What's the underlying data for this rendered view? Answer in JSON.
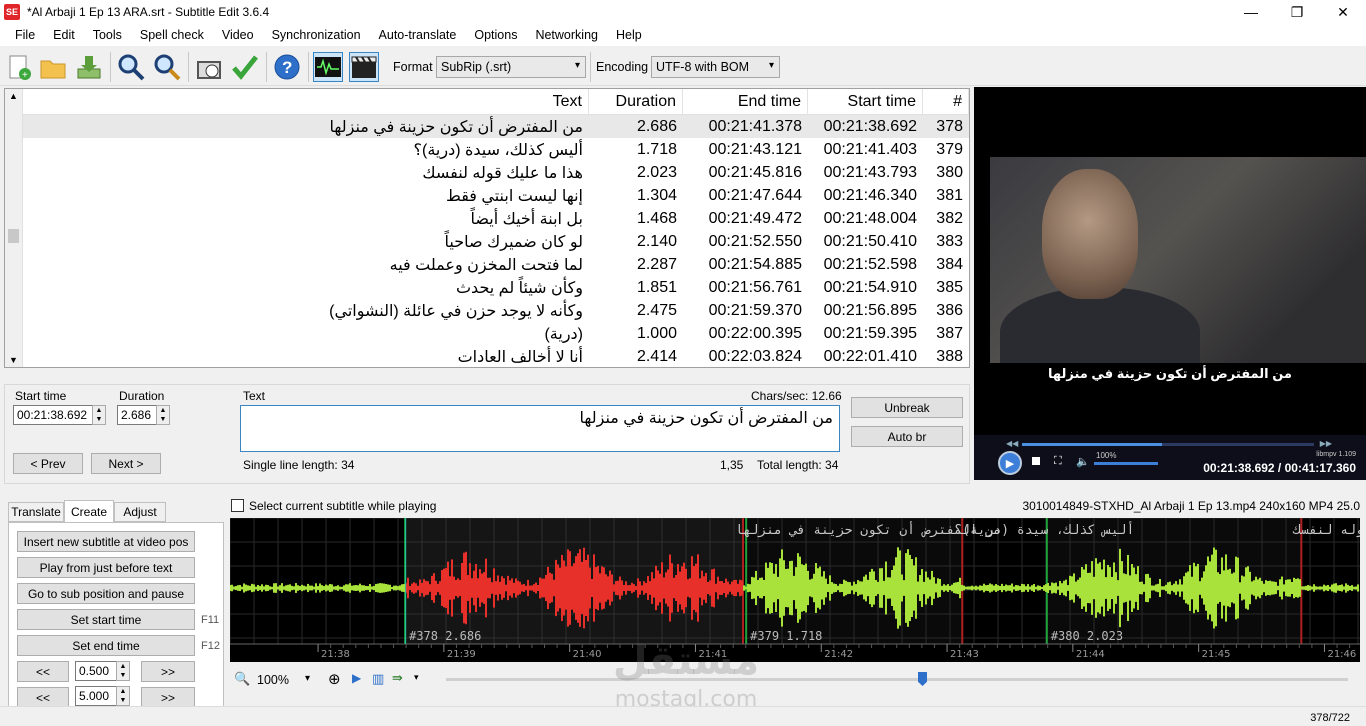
{
  "window": {
    "title": "*Al Arbaji 1 Ep 13 ARA.srt - Subtitle Edit 3.6.4",
    "icon_text": "SE"
  },
  "menu": [
    "File",
    "Edit",
    "Tools",
    "Spell check",
    "Video",
    "Synchronization",
    "Auto-translate",
    "Options",
    "Networking",
    "Help"
  ],
  "toolbar": {
    "format_label": "Format",
    "format_value": "SubRip (.srt)",
    "encoding_label": "Encoding",
    "encoding_value": "UTF-8 with BOM",
    "icons": [
      "new-file-icon",
      "open-folder-icon",
      "download-icon",
      "find-icon",
      "replace-icon",
      "visual-sync-icon",
      "spell-check-icon",
      "help-icon",
      "waveform-toggle-icon",
      "video-toggle-icon"
    ]
  },
  "grid": {
    "columns": [
      "Text",
      "Duration",
      "End time",
      "Start time",
      "#"
    ],
    "rows": [
      {
        "n": "378",
        "start": "00:21:38.692",
        "end": "00:21:41.378",
        "dur": "2.686",
        "text": "من المفترض أن تكون حزينة في منزلها"
      },
      {
        "n": "379",
        "start": "00:21:41.403",
        "end": "00:21:43.121",
        "dur": "1.718",
        "text": "أليس كذلك، سيدة (درية)؟"
      },
      {
        "n": "380",
        "start": "00:21:43.793",
        "end": "00:21:45.816",
        "dur": "2.023",
        "text": "هذا ما عليك قوله لنفسك"
      },
      {
        "n": "381",
        "start": "00:21:46.340",
        "end": "00:21:47.644",
        "dur": "1.304",
        "text": "إنها ليست ابنتي فقط"
      },
      {
        "n": "382",
        "start": "00:21:48.004",
        "end": "00:21:49.472",
        "dur": "1.468",
        "text": "بل ابنة أخيك أيضاً"
      },
      {
        "n": "383",
        "start": "00:21:50.410",
        "end": "00:21:52.550",
        "dur": "2.140",
        "text": "لو كان ضميرك صاحياً"
      },
      {
        "n": "384",
        "start": "00:21:52.598",
        "end": "00:21:54.885",
        "dur": "2.287",
        "text": "لما فتحت المخزن وعملت فيه"
      },
      {
        "n": "385",
        "start": "00:21:54.910",
        "end": "00:21:56.761",
        "dur": "1.851",
        "text": "وكأن شيئاً لم يحدث"
      },
      {
        "n": "386",
        "start": "00:21:56.895",
        "end": "00:21:59.370",
        "dur": "2.475",
        "text": "وكأنه لا يوجد حزن في عائلة (النشواتي)"
      },
      {
        "n": "387",
        "start": "00:21:59.395",
        "end": "00:22:00.395",
        "dur": "1.000",
        "text": "(درية)"
      },
      {
        "n": "388",
        "start": "00:22:01.410",
        "end": "00:22:03.824",
        "dur": "2.414",
        "text": "أنا لا أخالف العادات"
      }
    ]
  },
  "video": {
    "subtitle": "من المفترض أن تكون حزينة في منزلها",
    "time": "00:21:38.692 / 00:41:17.360",
    "volume": "100%",
    "libmpv": "libmpv 1.109"
  },
  "edit": {
    "start_label": "Start time",
    "start_value": "00:21:38.692",
    "duration_label": "Duration",
    "duration_value": "2.686",
    "text_label": "Text",
    "chars_sec": "Chars/sec: 12.66",
    "text_value": "من المفترض أن تكون حزينة في منزلها",
    "unbreak": "Unbreak",
    "auto_br": "Auto br",
    "prev": "< Prev",
    "next": "Next >",
    "single_line": "Single line length: 34",
    "pos": "1,35",
    "total_len": "Total length: 34"
  },
  "bottom": {
    "select_while_playing": "Select current subtitle while playing",
    "tabs": [
      "Translate",
      "Create",
      "Adjust"
    ],
    "create_buttons": [
      "Insert new subtitle at video pos",
      "Play from just before text",
      "Go to sub position and pause",
      "Set start time",
      "Set end time"
    ],
    "fkeys": [
      "F11",
      "F12"
    ],
    "step1": "0.500",
    "step2": "5.000",
    "back": "<<",
    "fwd": ">>",
    "video_info": "3010014849-STXHD_Al Arbaji 1 Ep 13.mp4 240x160 MP4 25.0",
    "zoom": "100%"
  },
  "waveform": {
    "subs": [
      {
        "label": "#378  2.686",
        "text": "من المفترض أن تكون حزينة في منزلها"
      },
      {
        "label": "#379  1.718",
        "text": "أليس كذلك، سيدة (درية)؟"
      },
      {
        "label": "#380  2.023",
        "text": "هذا ما عليك قوله لنفسك"
      }
    ],
    "ticks": [
      "21:38",
      "21:39",
      "21:40",
      "21:41",
      "21:42",
      "21:43",
      "21:44",
      "21:45",
      "21:46"
    ]
  },
  "status": {
    "count": "378/722"
  },
  "watermark": {
    "ar": "مستقل",
    "en": "mostaql.com"
  }
}
